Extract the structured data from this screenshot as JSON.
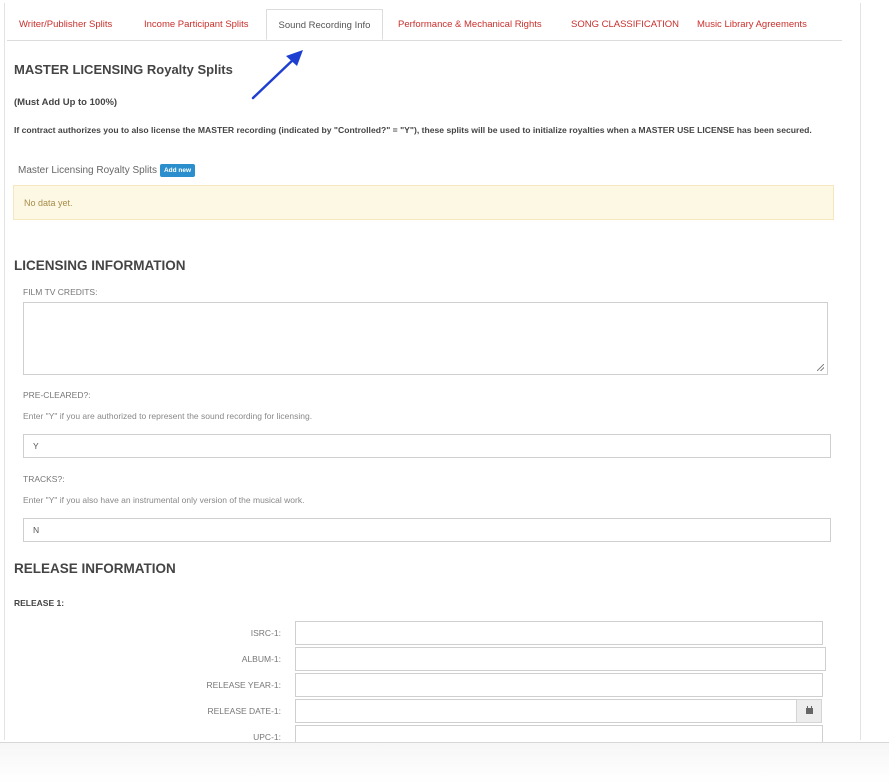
{
  "tabs": [
    {
      "label": "Writer/Publisher Splits"
    },
    {
      "label": "Income Participant Splits"
    },
    {
      "label": "Sound Recording Info"
    },
    {
      "label": "Performance & Mechanical Rights"
    },
    {
      "label": "SONG CLASSIFICATION"
    },
    {
      "label": "Music Library Agreements"
    }
  ],
  "master": {
    "title": "MASTER LICENSING Royalty Splits",
    "must_add": "(Must Add Up to 100%)",
    "description": "If contract authorizes you to also license the MASTER recording (indicated by \"Controlled?\" = \"Y\"), these splits will be used to initialize royalties when a MASTER USE LICENSE has been secured.",
    "splits_label": "Master Licensing Royalty Splits",
    "add_new": "Add new",
    "empty_text": "No data yet."
  },
  "licensing": {
    "title": "LICENSING INFORMATION",
    "film_tv_label": "FILM TV CREDITS:",
    "film_tv_value": "",
    "precleared_label": "PRE-CLEARED?:",
    "precleared_help": "Enter \"Y\" if you are authorized to represent the sound recording for licensing.",
    "precleared_value": "Y",
    "tracks_label": "TRACKS?:",
    "tracks_help": "Enter \"Y\" if you also have an instrumental only version of the musical work.",
    "tracks_value": "N"
  },
  "release": {
    "title": "RELEASE INFORMATION",
    "release1_label": "RELEASE 1:",
    "isrc_label": "ISRC-1:",
    "album_label": "ALBUM-1:",
    "year_label": "RELEASE YEAR-1:",
    "date_label": "RELEASE DATE-1:",
    "upc_label": "UPC-1:"
  },
  "colors": {
    "tab_link": "#c9302c",
    "add_button": "#2a8fcc",
    "alert_bg": "#fcf8e3",
    "arrow": "#1f3fd1"
  },
  "icons": {
    "calendar": "calendar-icon",
    "annotation_arrow": "arrow-annotation"
  }
}
